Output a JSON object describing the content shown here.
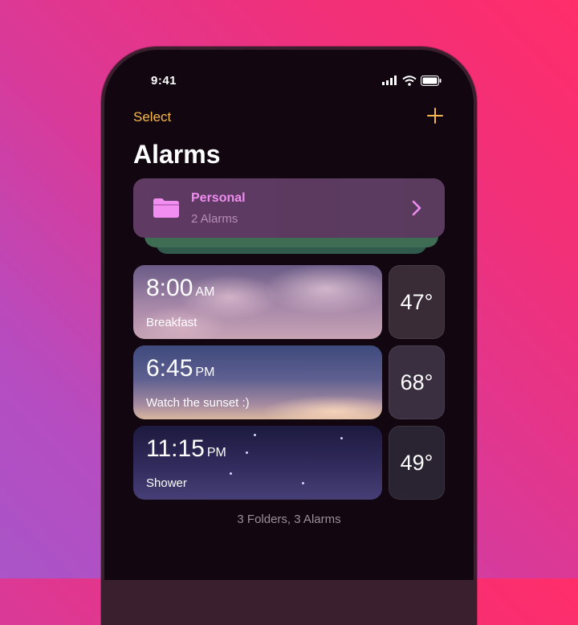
{
  "status_bar": {
    "time": "9:41"
  },
  "nav": {
    "select_label": "Select",
    "title": "Alarms"
  },
  "folder": {
    "name": "Personal",
    "count": "2 Alarms"
  },
  "alarms": [
    {
      "time": "8:00",
      "ampm": "AM",
      "label": "Breakfast",
      "temp": "47°"
    },
    {
      "time": "6:45",
      "ampm": "PM",
      "label": "Watch the sunset :)",
      "temp": "68°"
    },
    {
      "time": "11:15",
      "ampm": "PM",
      "label": "Shower",
      "temp": "49°"
    }
  ],
  "footer": {
    "summary": "3 Folders, 3 Alarms"
  },
  "colors": {
    "accent": "#f5b84a",
    "folder_text": "#ee8cf0",
    "background_pink": "#ff2d6a",
    "background_purple": "#a955c8"
  }
}
